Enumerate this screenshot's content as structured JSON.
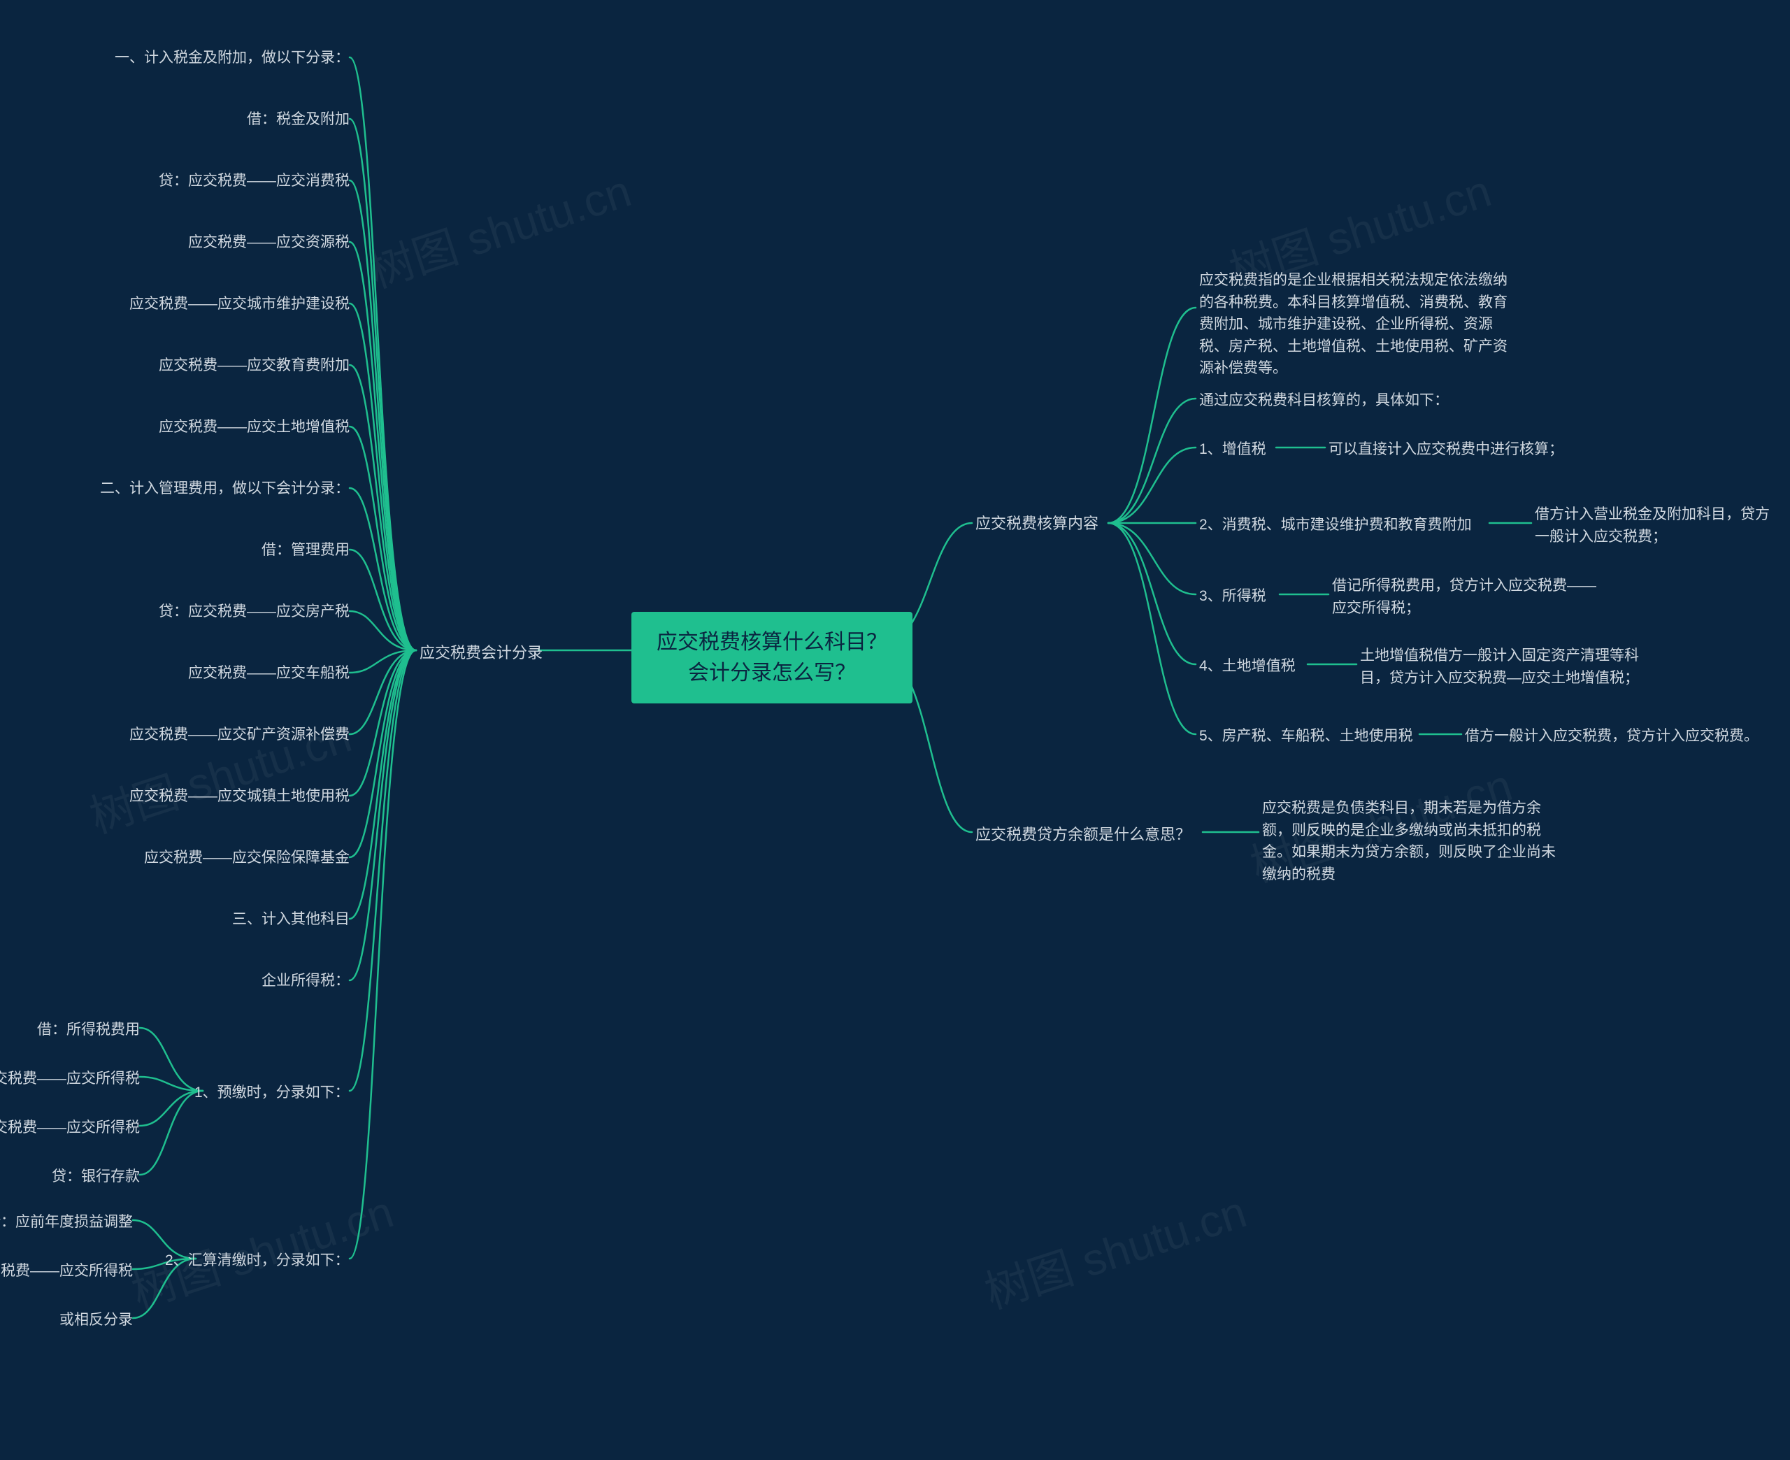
{
  "center": {
    "line1": "应交税费核算什么科目？",
    "line2": "会计分录怎么写？"
  },
  "right": {
    "branch1": {
      "label": "应交税费核算内容",
      "children": {
        "c1": "应交税费指的是企业根据相关税法规定依法缴纳的各种税费。本科目核算增值税、消费税、教育费附加、城市维护建设税、企业所得税、资源税、房产税、土地增值税、土地使用税、矿产资源补偿费等。",
        "c2": "通过应交税费科目核算的，具体如下：",
        "c3": {
          "label": "1、增值税",
          "detail": "可以直接计入应交税费中进行核算；"
        },
        "c4": {
          "label": "2、消费税、城市建设维护费和教育费附加",
          "detail": "借方计入营业税金及附加科目，贷方一般计入应交税费；"
        },
        "c5": {
          "label": "3、所得税",
          "detail": "借记所得税费用，贷方计入应交税费——应交所得税；"
        },
        "c6": {
          "label": "4、土地增值税",
          "detail": "土地增值税借方一般计入固定资产清理等科目，贷方计入应交税费—应交土地增值税；"
        },
        "c7": {
          "label": "5、房产税、车船税、土地使用税",
          "detail": "借方一般计入应交税费，贷方计入应交税费。"
        }
      }
    },
    "branch2": {
      "label": "应交税费贷方余额是什么意思？",
      "detail": "应交税费是负债类科目，期末若是为借方余额，则反映的是企业多缴纳或尚未抵扣的税金。如果期末为贷方余额，则反映了企业尚未缴纳的税费"
    }
  },
  "left": {
    "label": "应交税费会计分录",
    "items": [
      "一、计入税金及附加，做以下分录：",
      "借：税金及附加",
      "贷：应交税费——应交消费税",
      "应交税费——应交资源税",
      "应交税费——应交城市维护建设税",
      "应交税费——应交教育费附加",
      "应交税费——应交土地增值税",
      "二、计入管理费用，做以下会计分录：",
      "借：管理费用",
      "贷：应交税费——应交房产税",
      "应交税费——应交车船税",
      "应交税费——应交矿产资源补偿费",
      "应交税费——应交城镇土地使用税",
      "应交税费——应交保险保障基金",
      "三、计入其他科目",
      "企业所得税："
    ],
    "sub1": {
      "label": "1、预缴时，分录如下：",
      "items": [
        "借：所得税费用",
        "贷：应交税费——应交所得税",
        "借：应交税费——应交所得税",
        "贷：银行存款"
      ]
    },
    "sub2": {
      "label": "2、汇算清缴时，分录如下：",
      "items": [
        "借：应前年度损益调整",
        "贷：应交税费——应交所得税",
        "或相反分录"
      ]
    }
  },
  "watermarks": [
    "树图 shutu.cn"
  ]
}
